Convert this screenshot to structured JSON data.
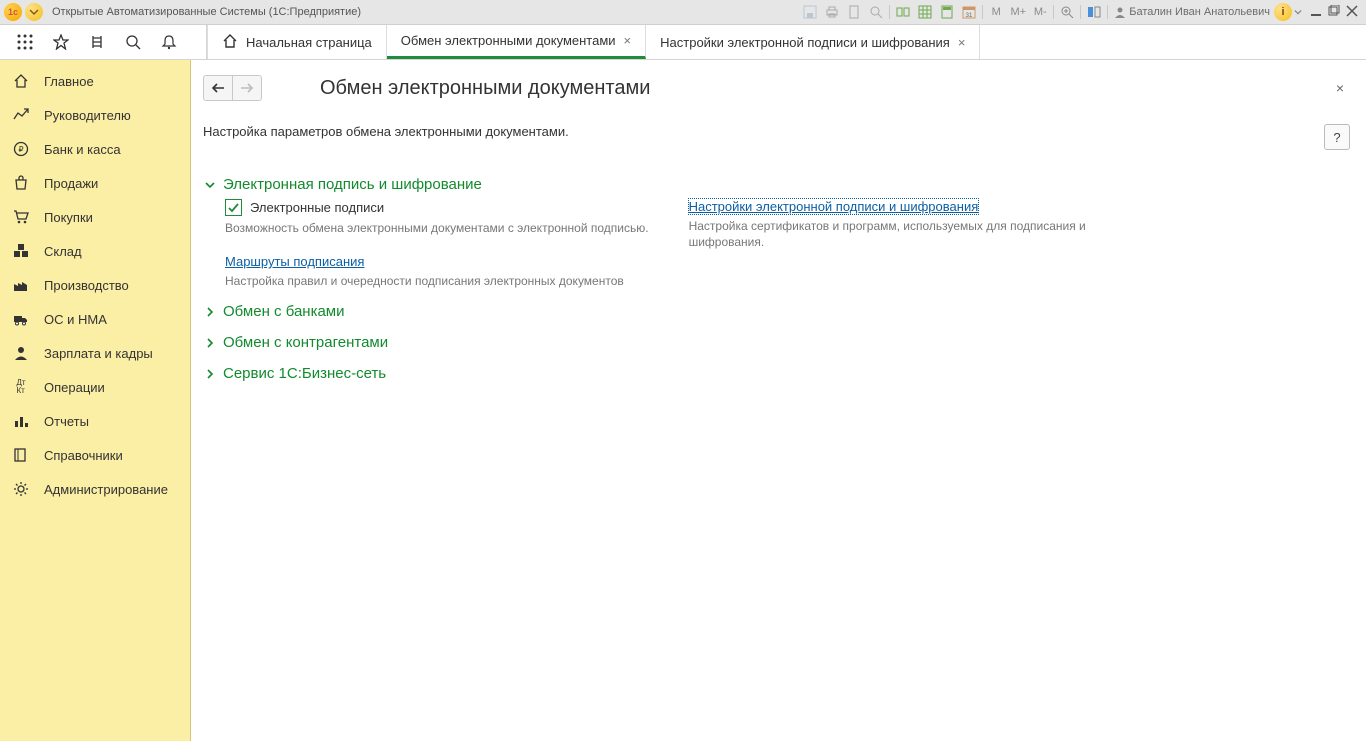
{
  "titlebar": {
    "app_title": "Открытые Автоматизированные Системы  (1С:Предприятие)",
    "user_name": "Баталин Иван Анатольевич",
    "m_labels": [
      "М",
      "М+",
      "М-"
    ]
  },
  "tabs": [
    {
      "label": "Начальная страница",
      "has_home_icon": true,
      "closable": false,
      "active": false
    },
    {
      "label": "Обмен электронными документами",
      "has_home_icon": false,
      "closable": true,
      "active": true
    },
    {
      "label": "Настройки электронной подписи и шифрования",
      "has_home_icon": false,
      "closable": true,
      "active": false
    }
  ],
  "sidebar": {
    "items": [
      {
        "label": "Главное",
        "icon": "home-icon"
      },
      {
        "label": "Руководителю",
        "icon": "chart-icon"
      },
      {
        "label": "Банк и касса",
        "icon": "ruble-icon"
      },
      {
        "label": "Продажи",
        "icon": "bag-icon"
      },
      {
        "label": "Покупки",
        "icon": "cart-icon"
      },
      {
        "label": "Склад",
        "icon": "boxes-icon"
      },
      {
        "label": "Производство",
        "icon": "factory-icon"
      },
      {
        "label": "ОС и НМА",
        "icon": "truck-icon"
      },
      {
        "label": "Зарплата и кадры",
        "icon": "person-icon"
      },
      {
        "label": "Операции",
        "icon": "dtkt-icon"
      },
      {
        "label": "Отчеты",
        "icon": "bars-icon"
      },
      {
        "label": "Справочники",
        "icon": "book-icon"
      },
      {
        "label": "Администрирование",
        "icon": "gear-icon"
      }
    ]
  },
  "page": {
    "title": "Обмен электронными документами",
    "description": "Настройка параметров обмена электронными документами.",
    "help_label": "?"
  },
  "section_sig": {
    "title": "Электронная подпись и шифрование",
    "checkbox_label": "Электронные подписи",
    "checkbox_checked": true,
    "checkbox_desc": "Возможность обмена электронными документами с электронной подписью.",
    "right_link": "Настройки электронной подписи и шифрования",
    "right_desc": "Настройка сертификатов и программ, используемых для подписания и шифрования.",
    "routes_link": "Маршруты подписания",
    "routes_desc": "Настройка правил и очередности подписания электронных документов"
  },
  "section_banks": {
    "title": "Обмен с банками"
  },
  "section_partners": {
    "title": "Обмен с контрагентами"
  },
  "section_service": {
    "title": "Сервис 1С:Бизнес-сеть"
  }
}
